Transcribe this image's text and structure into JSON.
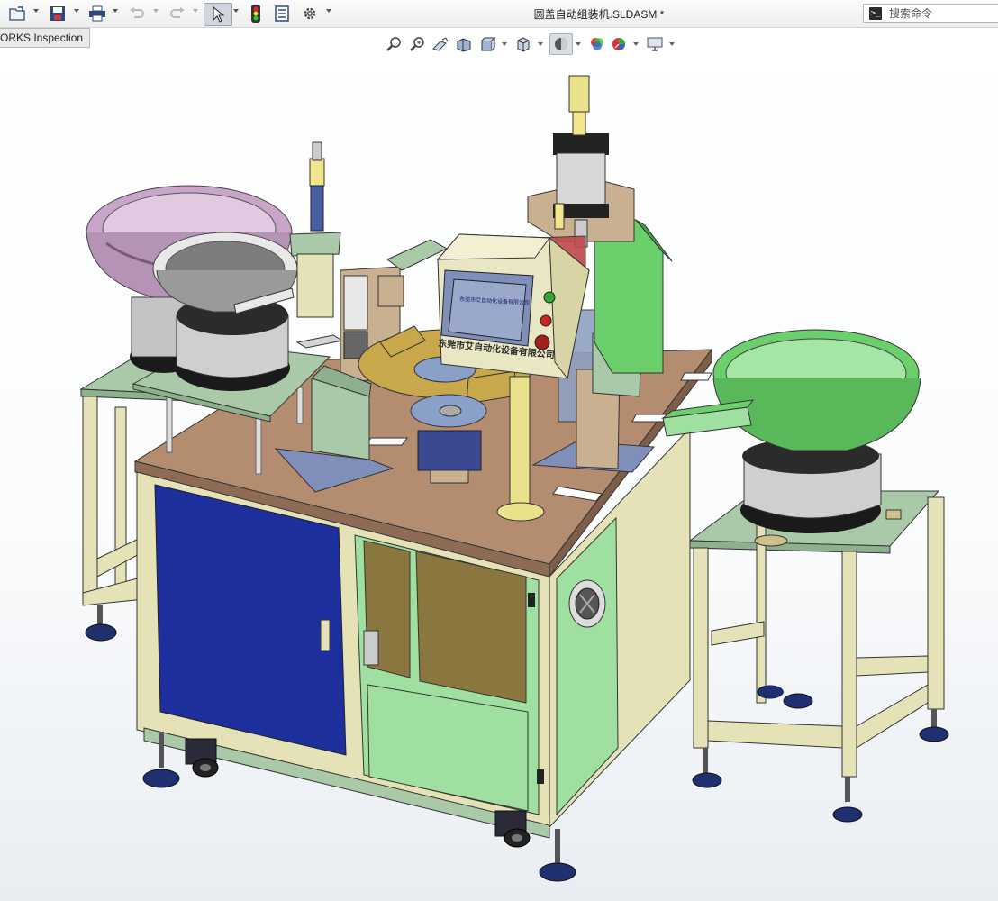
{
  "window": {
    "document_title": "圆盖自动组装机.SLDASM *"
  },
  "toolbar": {
    "items": [
      "open-icon",
      "save-icon",
      "print-icon",
      "undo-icon",
      "redo-icon",
      "select-icon",
      "rebuild-icon",
      "file-properties-icon",
      "options-icon"
    ]
  },
  "search": {
    "placeholder": "搜索命令",
    "icon": "command-prompt-icon"
  },
  "inspection_tab": {
    "label": "ORKS Inspection"
  },
  "heads_up_toolbar": {
    "items": [
      "zoom-to-fit-icon",
      "zoom-to-area-icon",
      "previous-view-icon",
      "section-view-icon",
      "dynamic-annotation-icon",
      "view-orientation-icon",
      "display-style-icon",
      "hide-show-items-icon",
      "edit-appearance-icon",
      "apply-scene-icon",
      "view-settings-icon"
    ]
  },
  "model": {
    "hmi_label": "东莞市艾自动化设备有限公司",
    "screen_text": "东莞市艾自动化设备有限公司",
    "colors": {
      "table_top": "#b48c70",
      "frame": "#e6e2b8",
      "panel_green": "#9fe0a0",
      "door_blue": "#1c2f9c",
      "plate_green": "#a9c9a9",
      "bowl_purple": "#c9a6c9",
      "bowl_green": "#6bd06b",
      "gold_plate": "#c8a84a",
      "hmi_beige": "#e9e6c4",
      "hmi_screen": "#7f8fb9",
      "cylinder_gray": "#b8b8b8",
      "feet_navy": "#1f2f6f"
    }
  }
}
